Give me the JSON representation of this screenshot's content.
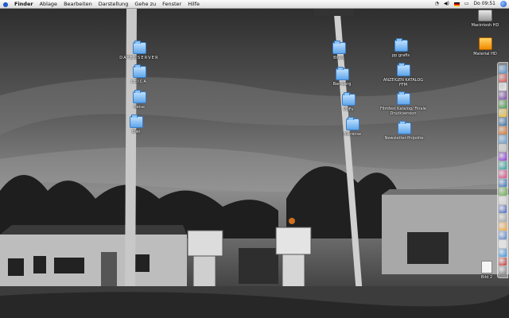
{
  "menubar": {
    "apple_icon": "apple-icon",
    "items": [
      "Finder",
      "Ablage",
      "Bearbeiten",
      "Darstellung",
      "Gehe zu",
      "Fenster",
      "Hilfe"
    ],
    "clock": "Do 09:51"
  },
  "desktop": {
    "left_folders": [
      {
        "label": "DATENSERVER"
      },
      {
        "label": "LEICA"
      },
      {
        "label": "Heise"
      },
      {
        "label": "Biwi"
      }
    ],
    "middle_folders": [
      {
        "label": "Blues"
      },
      {
        "label": "Bamberg"
      },
      {
        "label": "PDFs"
      },
      {
        "label": "Alltränse"
      }
    ],
    "right_folders": [
      {
        "label": "pp grafis"
      },
      {
        "label": "ANZEIGEN KATALOG FFM"
      },
      {
        "label": "Filmfest Katalog/ Finale Druckversion"
      },
      {
        "label": "Newsletter-Projekte"
      }
    ],
    "volumes": [
      {
        "label": "Macintosh HD",
        "icon": "hard-drive-icon"
      },
      {
        "label": "Material HD",
        "icon": "drive-icon"
      }
    ],
    "bottom_file": {
      "label": "Bild 2",
      "icon": "image-file-icon"
    }
  },
  "dock": {
    "colors": [
      "#4a90d9",
      "#d94a4a",
      "#e8e8e8",
      "#7a3fb0",
      "#3b9b3b",
      "#f0c020",
      "#2b6cb0",
      "#e07020",
      "#5aa0e0",
      "#c0c0c0",
      "#8a2be2",
      "#20a0a0",
      "#e04080",
      "#3070c0",
      "#60b040",
      "#d0d0d0",
      "#4060c0",
      "#a0a0a0",
      "#f0a030",
      "#5080d0",
      "#e0e0e0",
      "#3090e0",
      "#c03030",
      "#808080"
    ]
  }
}
